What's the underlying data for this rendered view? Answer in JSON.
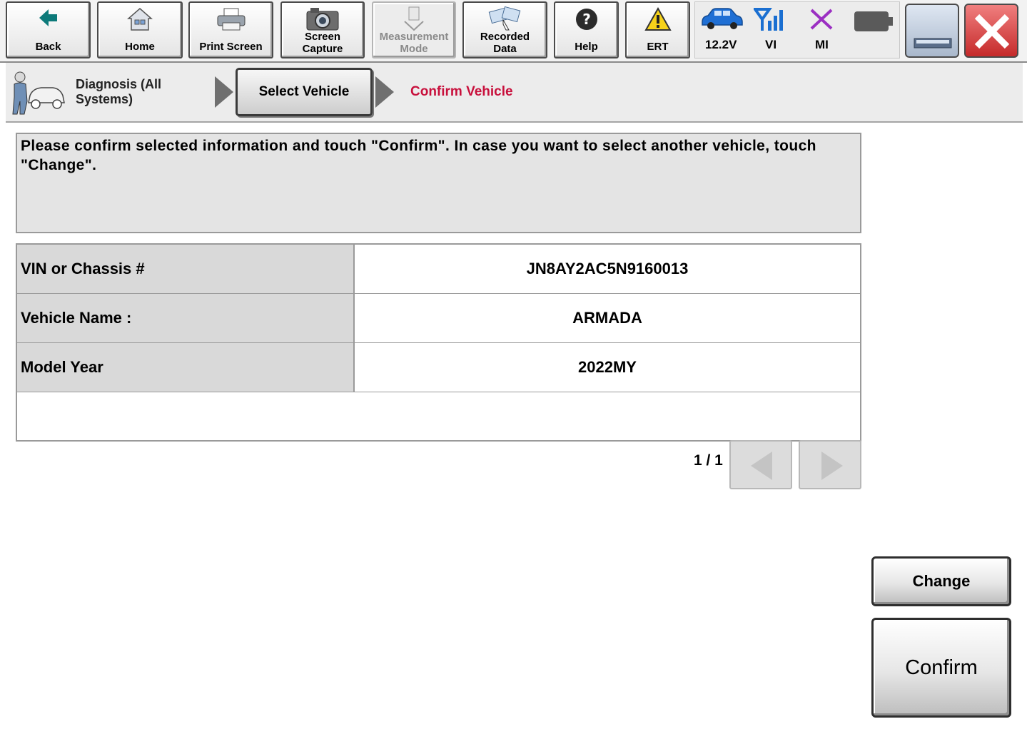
{
  "toolbar": {
    "back": "Back",
    "home": "Home",
    "print_screen": "Print Screen",
    "screen_capture": "Screen\nCapture",
    "measurement_mode": "Measurement\nMode",
    "recorded_data": "Recorded\nData",
    "help": "Help",
    "ert": "ERT"
  },
  "status": {
    "voltage": "12.2V",
    "vi": "VI",
    "mi": "MI"
  },
  "breadcrumb": {
    "diagnosis": "Diagnosis (All\nSystems)",
    "select_vehicle": "Select Vehicle",
    "confirm_vehicle": "Confirm Vehicle"
  },
  "message": "Please confirm selected information and touch \"Confirm\". In case you want to select another vehicle, touch \"Change\".",
  "table": {
    "rows": [
      {
        "label": "VIN or Chassis #",
        "value": "JN8AY2AC5N9160013"
      },
      {
        "label": "Vehicle Name :",
        "value": "ARMADA"
      },
      {
        "label": "Model Year",
        "value": "2022MY"
      }
    ]
  },
  "pager": {
    "text": "1 / 1"
  },
  "actions": {
    "change": "Change",
    "confirm": "Confirm"
  },
  "colors": {
    "accent_red": "#c8103c",
    "status_blue": "#1a6fd1",
    "status_purple": "#9b2fc2"
  }
}
